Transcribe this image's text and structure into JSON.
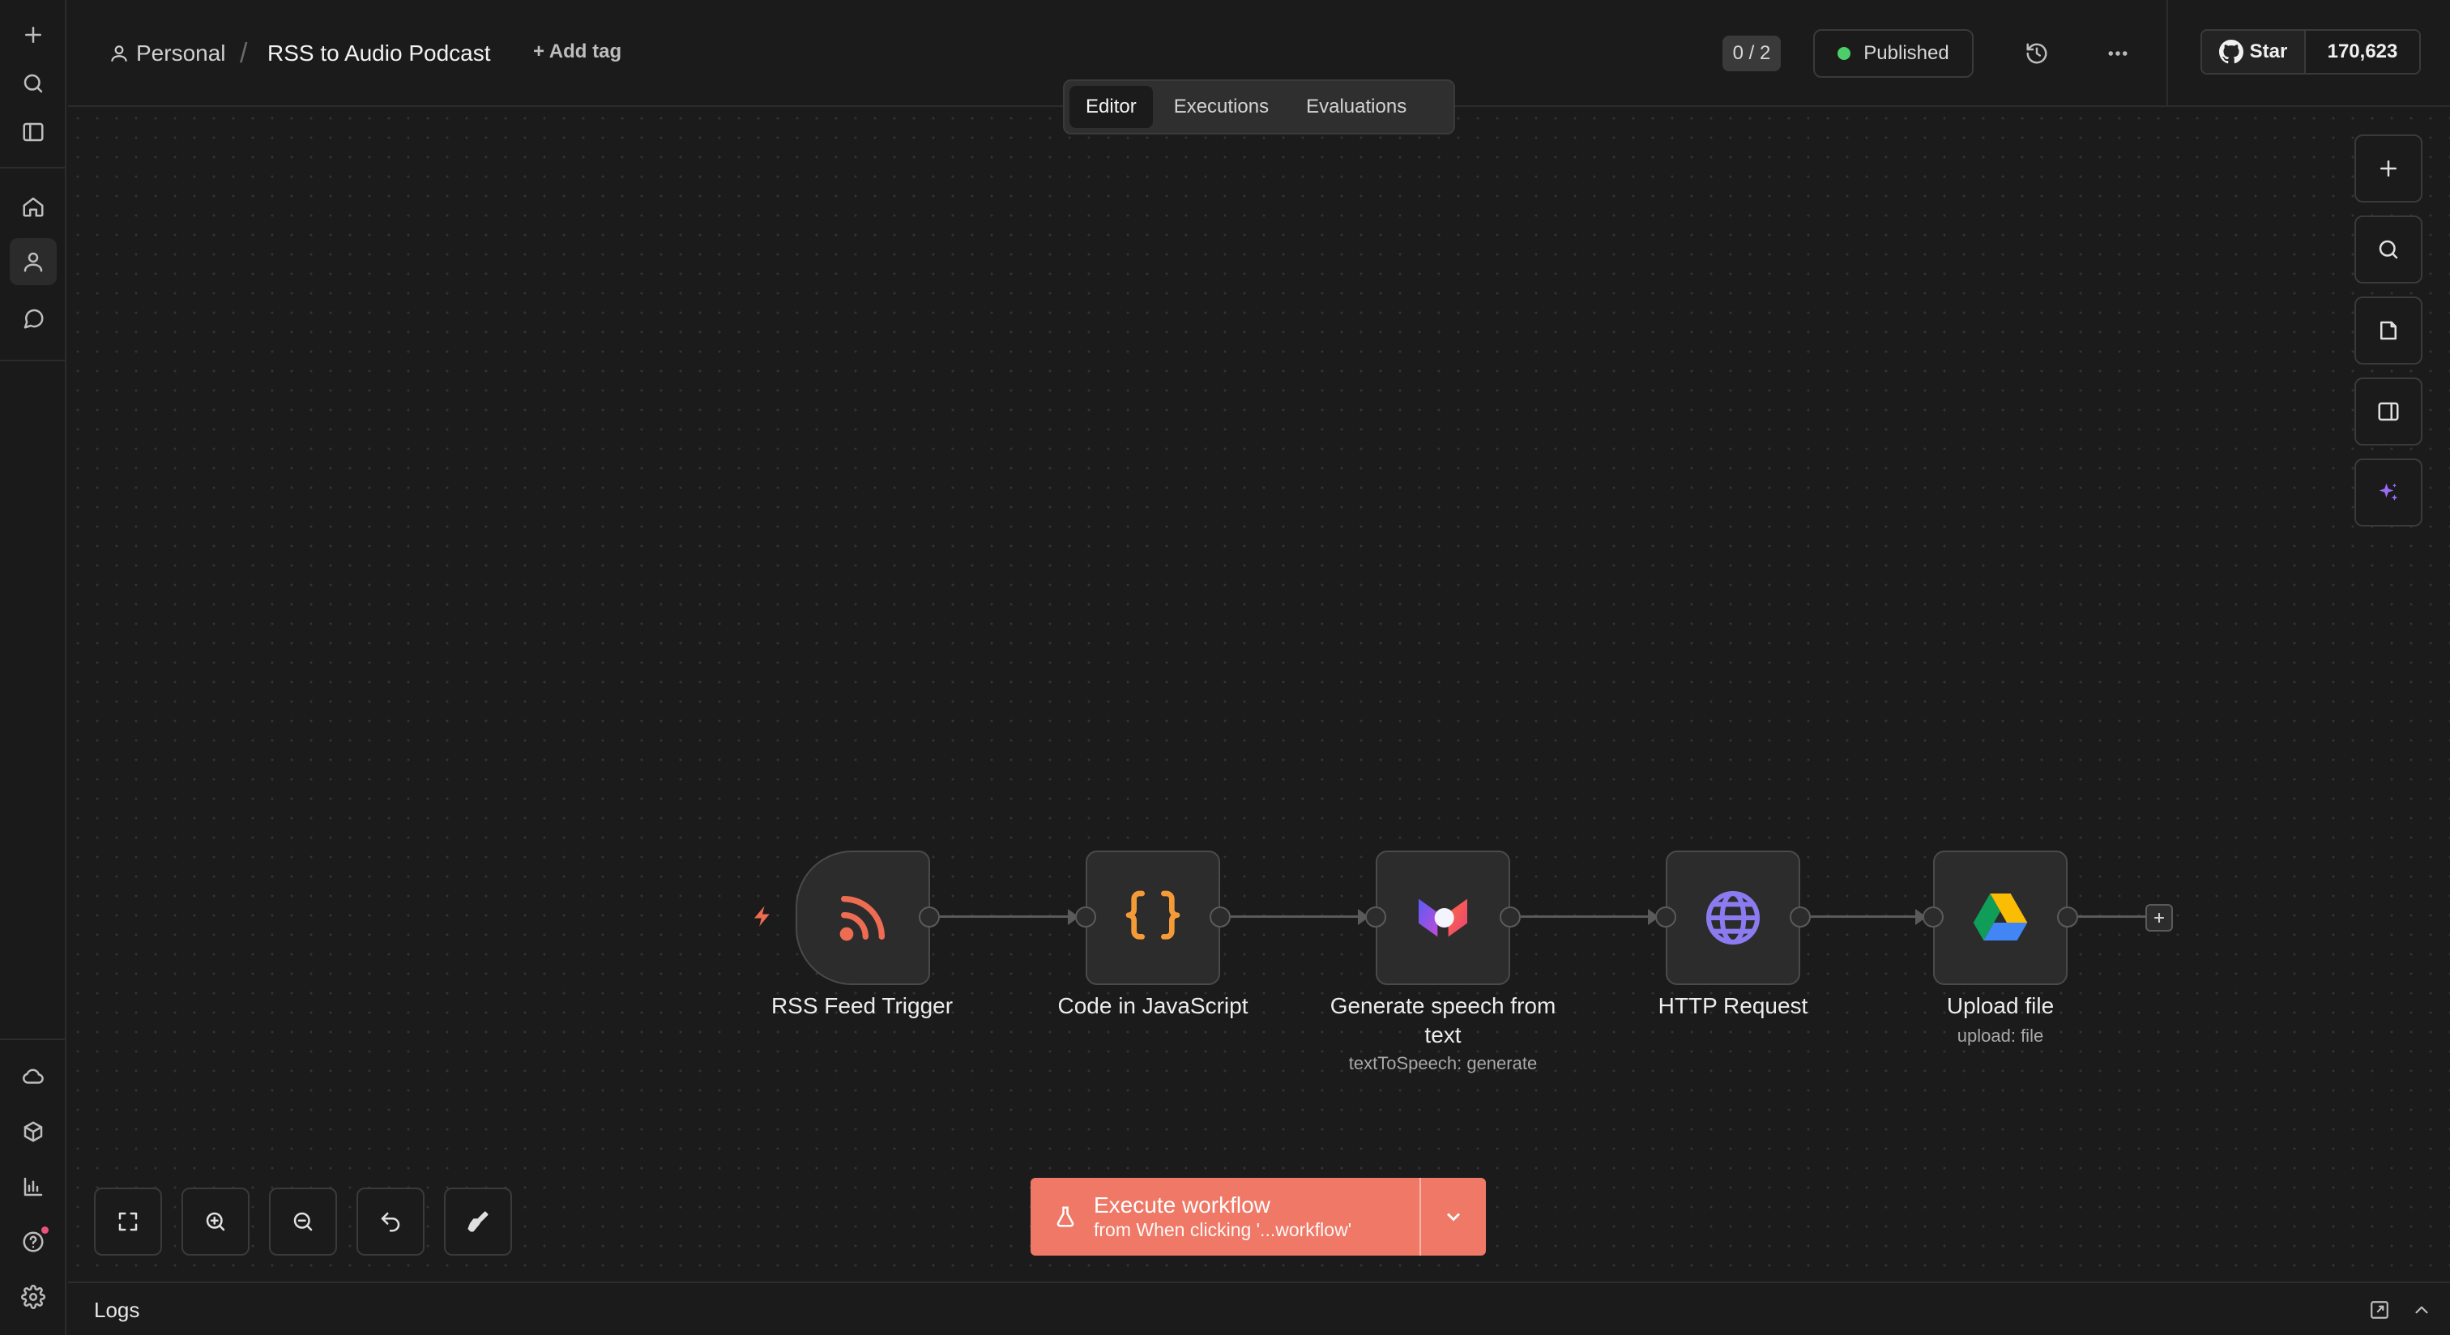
{
  "header": {
    "project": "Personal",
    "separator": "/",
    "workflow_title": "RSS to Audio Podcast",
    "add_tag": "+ Add tag",
    "counter": "0 / 2",
    "status": "Published",
    "github_star": "Star",
    "github_count": "170,623"
  },
  "tabs": [
    {
      "label": "Editor",
      "active": true
    },
    {
      "label": "Executions",
      "active": false
    },
    {
      "label": "Evaluations",
      "active": false
    }
  ],
  "nodes": [
    {
      "label": "RSS Feed Trigger",
      "icon": "rss-icon"
    },
    {
      "label": "Code in JavaScript",
      "icon": "code-braces-icon"
    },
    {
      "label_line1": "Generate speech from",
      "label_line2": "text",
      "subtitle": "textToSpeech: generate",
      "icon": "ai-speech-icon"
    },
    {
      "label": "HTTP Request",
      "icon": "globe-icon"
    },
    {
      "label": "Upload file",
      "subtitle": "upload: file",
      "icon": "google-drive-icon"
    }
  ],
  "execute": {
    "title": "Execute workflow",
    "subtitle": "from When clicking '...workflow'"
  },
  "logs": {
    "label": "Logs"
  },
  "colors": {
    "accent": "#ef7866",
    "published_dot": "#4cce6b",
    "rss": "#ee6c52",
    "code": "#f49b38",
    "globe": "#8a7cf0",
    "sparkle": "#9b6bf5"
  }
}
